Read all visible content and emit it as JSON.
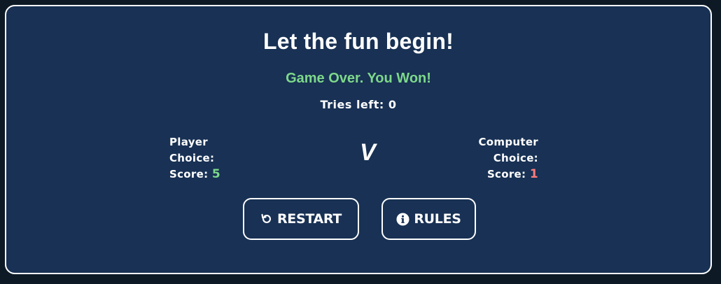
{
  "title": "Let the fun begin!",
  "result_text": "Game Over. You Won!",
  "tries": {
    "label": "Tries left:",
    "value": "0"
  },
  "player": {
    "label_line1": "Player",
    "choice_label": "Choice:",
    "score_label": "Score:",
    "score_value": "5"
  },
  "computer": {
    "label_line1": "Computer",
    "choice_label": "Choice:",
    "score_label": "Score:",
    "score_value": "1"
  },
  "versus": "V",
  "buttons": {
    "restart": {
      "label": "RESTART",
      "icon": "restart-icon"
    },
    "rules": {
      "label": "RULES",
      "icon": "info-icon"
    }
  },
  "colors": {
    "panel_bg": "#183154",
    "page_bg": "#0d1a26",
    "win_green": "#7dd88a",
    "loss_red": "#ff7b7b",
    "text": "#ffffff"
  }
}
